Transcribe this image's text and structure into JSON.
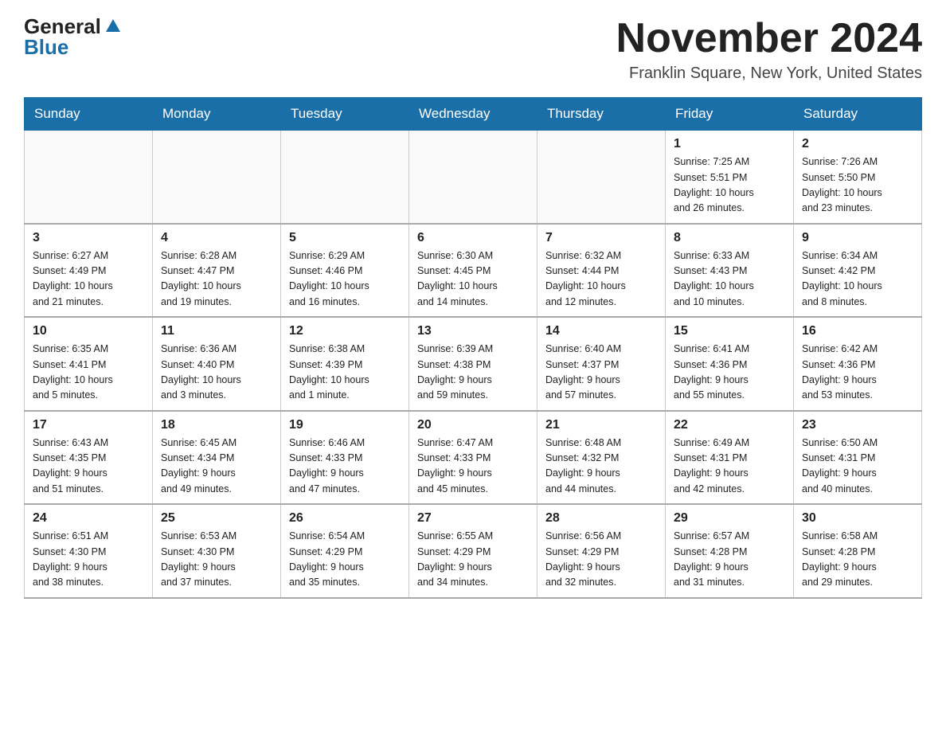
{
  "logo": {
    "general": "General",
    "blue": "Blue"
  },
  "title": "November 2024",
  "location": "Franklin Square, New York, United States",
  "days_of_week": [
    "Sunday",
    "Monday",
    "Tuesday",
    "Wednesday",
    "Thursday",
    "Friday",
    "Saturday"
  ],
  "weeks": [
    [
      {
        "day": "",
        "info": ""
      },
      {
        "day": "",
        "info": ""
      },
      {
        "day": "",
        "info": ""
      },
      {
        "day": "",
        "info": ""
      },
      {
        "day": "",
        "info": ""
      },
      {
        "day": "1",
        "info": "Sunrise: 7:25 AM\nSunset: 5:51 PM\nDaylight: 10 hours\nand 26 minutes."
      },
      {
        "day": "2",
        "info": "Sunrise: 7:26 AM\nSunset: 5:50 PM\nDaylight: 10 hours\nand 23 minutes."
      }
    ],
    [
      {
        "day": "3",
        "info": "Sunrise: 6:27 AM\nSunset: 4:49 PM\nDaylight: 10 hours\nand 21 minutes."
      },
      {
        "day": "4",
        "info": "Sunrise: 6:28 AM\nSunset: 4:47 PM\nDaylight: 10 hours\nand 19 minutes."
      },
      {
        "day": "5",
        "info": "Sunrise: 6:29 AM\nSunset: 4:46 PM\nDaylight: 10 hours\nand 16 minutes."
      },
      {
        "day": "6",
        "info": "Sunrise: 6:30 AM\nSunset: 4:45 PM\nDaylight: 10 hours\nand 14 minutes."
      },
      {
        "day": "7",
        "info": "Sunrise: 6:32 AM\nSunset: 4:44 PM\nDaylight: 10 hours\nand 12 minutes."
      },
      {
        "day": "8",
        "info": "Sunrise: 6:33 AM\nSunset: 4:43 PM\nDaylight: 10 hours\nand 10 minutes."
      },
      {
        "day": "9",
        "info": "Sunrise: 6:34 AM\nSunset: 4:42 PM\nDaylight: 10 hours\nand 8 minutes."
      }
    ],
    [
      {
        "day": "10",
        "info": "Sunrise: 6:35 AM\nSunset: 4:41 PM\nDaylight: 10 hours\nand 5 minutes."
      },
      {
        "day": "11",
        "info": "Sunrise: 6:36 AM\nSunset: 4:40 PM\nDaylight: 10 hours\nand 3 minutes."
      },
      {
        "day": "12",
        "info": "Sunrise: 6:38 AM\nSunset: 4:39 PM\nDaylight: 10 hours\nand 1 minute."
      },
      {
        "day": "13",
        "info": "Sunrise: 6:39 AM\nSunset: 4:38 PM\nDaylight: 9 hours\nand 59 minutes."
      },
      {
        "day": "14",
        "info": "Sunrise: 6:40 AM\nSunset: 4:37 PM\nDaylight: 9 hours\nand 57 minutes."
      },
      {
        "day": "15",
        "info": "Sunrise: 6:41 AM\nSunset: 4:36 PM\nDaylight: 9 hours\nand 55 minutes."
      },
      {
        "day": "16",
        "info": "Sunrise: 6:42 AM\nSunset: 4:36 PM\nDaylight: 9 hours\nand 53 minutes."
      }
    ],
    [
      {
        "day": "17",
        "info": "Sunrise: 6:43 AM\nSunset: 4:35 PM\nDaylight: 9 hours\nand 51 minutes."
      },
      {
        "day": "18",
        "info": "Sunrise: 6:45 AM\nSunset: 4:34 PM\nDaylight: 9 hours\nand 49 minutes."
      },
      {
        "day": "19",
        "info": "Sunrise: 6:46 AM\nSunset: 4:33 PM\nDaylight: 9 hours\nand 47 minutes."
      },
      {
        "day": "20",
        "info": "Sunrise: 6:47 AM\nSunset: 4:33 PM\nDaylight: 9 hours\nand 45 minutes."
      },
      {
        "day": "21",
        "info": "Sunrise: 6:48 AM\nSunset: 4:32 PM\nDaylight: 9 hours\nand 44 minutes."
      },
      {
        "day": "22",
        "info": "Sunrise: 6:49 AM\nSunset: 4:31 PM\nDaylight: 9 hours\nand 42 minutes."
      },
      {
        "day": "23",
        "info": "Sunrise: 6:50 AM\nSunset: 4:31 PM\nDaylight: 9 hours\nand 40 minutes."
      }
    ],
    [
      {
        "day": "24",
        "info": "Sunrise: 6:51 AM\nSunset: 4:30 PM\nDaylight: 9 hours\nand 38 minutes."
      },
      {
        "day": "25",
        "info": "Sunrise: 6:53 AM\nSunset: 4:30 PM\nDaylight: 9 hours\nand 37 minutes."
      },
      {
        "day": "26",
        "info": "Sunrise: 6:54 AM\nSunset: 4:29 PM\nDaylight: 9 hours\nand 35 minutes."
      },
      {
        "day": "27",
        "info": "Sunrise: 6:55 AM\nSunset: 4:29 PM\nDaylight: 9 hours\nand 34 minutes."
      },
      {
        "day": "28",
        "info": "Sunrise: 6:56 AM\nSunset: 4:29 PM\nDaylight: 9 hours\nand 32 minutes."
      },
      {
        "day": "29",
        "info": "Sunrise: 6:57 AM\nSunset: 4:28 PM\nDaylight: 9 hours\nand 31 minutes."
      },
      {
        "day": "30",
        "info": "Sunrise: 6:58 AM\nSunset: 4:28 PM\nDaylight: 9 hours\nand 29 minutes."
      }
    ]
  ]
}
